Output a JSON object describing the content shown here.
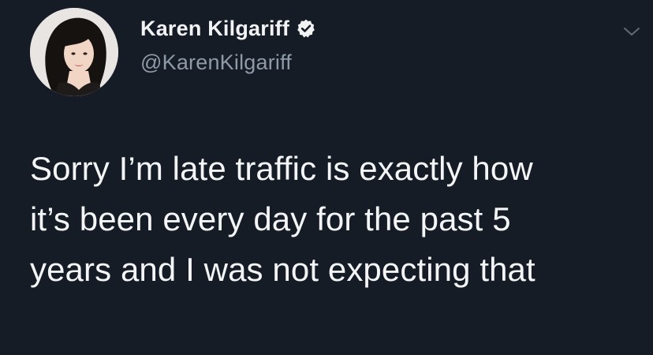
{
  "tweet": {
    "author": {
      "display_name": "Karen Kilgariff",
      "handle": "@KarenKilgariff",
      "verified": true
    },
    "text": "Sorry I’m late traffic is exactly how\nit’s been every day for the past 5\nyears and I was not expecting that"
  },
  "icons": {
    "verified": "verified-badge-icon",
    "menu": "chevron-down-icon"
  },
  "colors": {
    "background": "#151c26",
    "text_primary": "#f4f5f7",
    "text_secondary": "#8e9aa8"
  }
}
